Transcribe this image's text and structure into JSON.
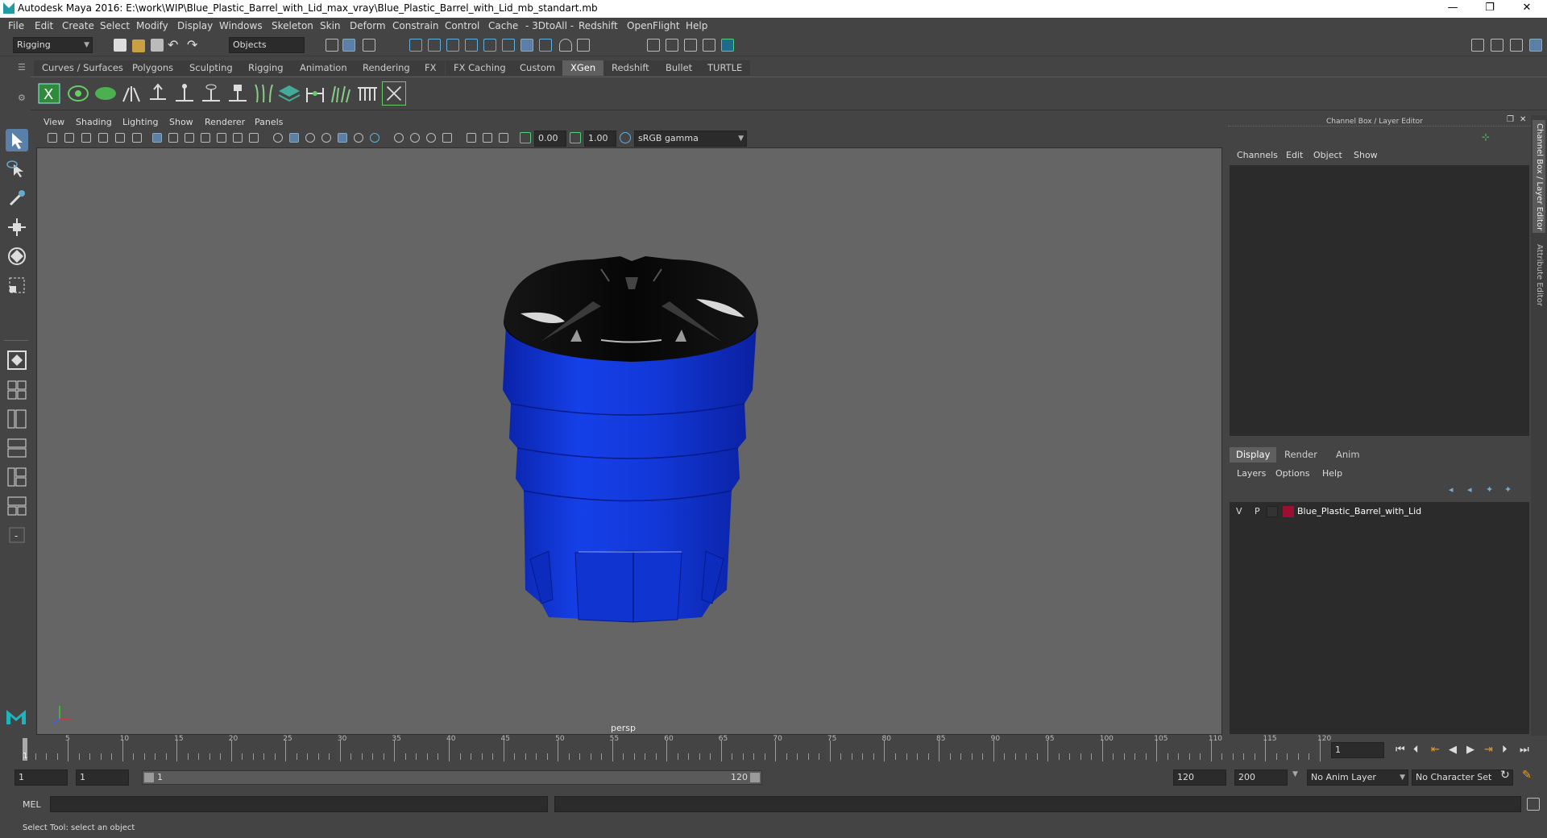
{
  "window": {
    "title": "Autodesk Maya 2016: E:\\work\\WIP\\Blue_Plastic_Barrel_with_Lid_max_vray\\Blue_Plastic_Barrel_with_Lid_mb_standart.mb",
    "minimize": "—",
    "restore": "❐",
    "close": "✕"
  },
  "menubar": [
    "File",
    "Edit",
    "Create",
    "Select",
    "Modify",
    "Display",
    "Windows",
    "Skeleton",
    "Skin",
    "Deform",
    "Constrain",
    "Control",
    "Cache",
    "- 3DtoAll -",
    "Redshift",
    "OpenFlight",
    "Help"
  ],
  "statusline": {
    "menuset": "Rigging",
    "selection_mode": "Objects"
  },
  "shelf_tabs": [
    "Curves / Surfaces",
    "Polygons",
    "Sculpting",
    "Rigging",
    "Animation",
    "Rendering",
    "FX",
    "FX Caching",
    "Custom",
    "XGen",
    "Redshift",
    "Bullet",
    "TURTLE"
  ],
  "active_shelf_tab": "XGen",
  "viewport": {
    "menu": [
      "View",
      "Shading",
      "Lighting",
      "Show",
      "Renderer",
      "Panels"
    ],
    "exposure": "0.00",
    "gamma": "1.00",
    "color_space": "sRGB gamma",
    "camera_label": "persp",
    "colors": {
      "background": "#656565",
      "barrel": "#1238d8",
      "lid": "#0e0e0e"
    }
  },
  "channel_box": {
    "title": "Channel Box / Layer Editor",
    "menu": [
      "Channels",
      "Edit",
      "Object",
      "Show"
    ]
  },
  "layer_editor": {
    "tabs": [
      "Display",
      "Render",
      "Anim"
    ],
    "active_tab": "Display",
    "menu": [
      "Layers",
      "Options",
      "Help"
    ],
    "layers": [
      {
        "visible": "V",
        "playback": "P",
        "name": "Blue_Plastic_Barrel_with_Lid",
        "color": "#9a1030"
      }
    ]
  },
  "side_tabs": [
    "Channel Box / Layer Editor",
    "Attribute Editor"
  ],
  "timeline": {
    "ticks": [
      "1",
      "5",
      "10",
      "15",
      "20",
      "25",
      "30",
      "35",
      "40",
      "45",
      "50",
      "55",
      "60",
      "65",
      "70",
      "75",
      "80",
      "85",
      "90",
      "95",
      "100",
      "105",
      "110",
      "115",
      "120"
    ],
    "current_frame": "1"
  },
  "range": {
    "start": "1",
    "playback_start": "1",
    "slider_start": "1",
    "slider_end": "120",
    "playback_end": "120",
    "end": "200",
    "anim_layer": "No Anim Layer",
    "character_set": "No Character Set"
  },
  "command_line": {
    "label": "MEL"
  },
  "help_line": "Select Tool: select an object"
}
